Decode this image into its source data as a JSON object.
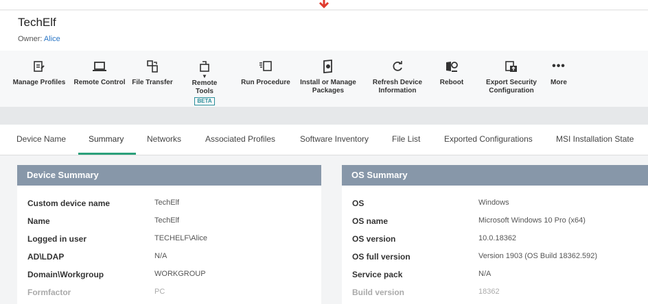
{
  "header": {
    "title": "TechElf",
    "owner_label": "Owner:",
    "owner_name": "Alice"
  },
  "toolbar": {
    "items": [
      {
        "label": "Manage Profiles",
        "icon": "manage-profiles-icon"
      },
      {
        "label": "Remote Control",
        "icon": "laptop-icon"
      },
      {
        "label": "File Transfer",
        "icon": "file-transfer-icon"
      },
      {
        "label": "Remote Tools",
        "icon": "remote-tools-icon",
        "badge": "BETA"
      },
      {
        "label": "Run Procedure",
        "icon": "run-procedure-icon"
      },
      {
        "label": "Install or Manage Packages",
        "icon": "package-icon"
      },
      {
        "label": "Refresh Device Information",
        "icon": "refresh-icon"
      },
      {
        "label": "Reboot",
        "icon": "reboot-icon"
      },
      {
        "label": "Export Security Configuration",
        "icon": "export-icon"
      },
      {
        "label": "More",
        "icon": "more-icon"
      }
    ]
  },
  "tabs": [
    {
      "label": "Device Name"
    },
    {
      "label": "Summary"
    },
    {
      "label": "Networks"
    },
    {
      "label": "Associated Profiles"
    },
    {
      "label": "Software Inventory"
    },
    {
      "label": "File List"
    },
    {
      "label": "Exported Configurations"
    },
    {
      "label": "MSI Installation State"
    }
  ],
  "active_tab": "Summary",
  "device_summary": {
    "title": "Device Summary",
    "rows": [
      {
        "key": "Custom device name",
        "value": "TechElf"
      },
      {
        "key": "Name",
        "value": "TechElf"
      },
      {
        "key": "Logged in user",
        "value": "TECHELF\\Alice"
      },
      {
        "key": "AD\\LDAP",
        "value": "N/A"
      },
      {
        "key": "Domain\\Workgroup",
        "value": "WORKGROUP"
      },
      {
        "key": "Formfactor",
        "value": "PC"
      }
    ]
  },
  "os_summary": {
    "title": "OS Summary",
    "rows": [
      {
        "key": "OS",
        "value": "Windows"
      },
      {
        "key": "OS name",
        "value": "Microsoft Windows 10 Pro (x64)"
      },
      {
        "key": "OS version",
        "value": "10.0.18362"
      },
      {
        "key": "OS full version",
        "value": "Version 1903 (OS Build 18362.592)"
      },
      {
        "key": "Service pack",
        "value": "N/A"
      },
      {
        "key": "Build version",
        "value": "18362"
      }
    ]
  },
  "colors": {
    "accent": "#2aa07a",
    "panel_header": "#8797a9",
    "link": "#2a76c6",
    "arrow": "#e03a2e"
  }
}
